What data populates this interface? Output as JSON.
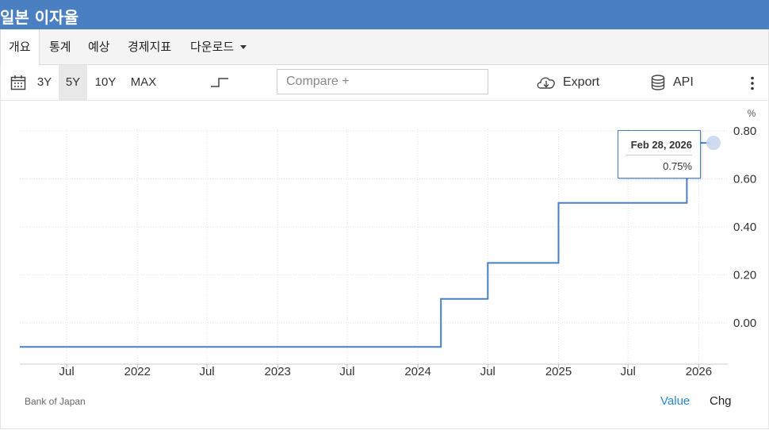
{
  "header": {
    "title": "일본 이자율"
  },
  "tabs": [
    {
      "label": "개요"
    },
    {
      "label": "통계"
    },
    {
      "label": "예상"
    },
    {
      "label": "경제지표"
    },
    {
      "label": "다운로드"
    }
  ],
  "toolbar": {
    "ranges": [
      "3Y",
      "5Y",
      "10Y",
      "MAX"
    ],
    "selected_range": "5Y",
    "compare_placeholder": "Compare +",
    "export_label": "Export",
    "api_label": "API",
    "icons": [
      "calendar-icon",
      "step-line-icon",
      "cloud-download-icon",
      "database-icon",
      "more-vert-icon"
    ]
  },
  "footer": {
    "source": "Bank of Japan",
    "value_label": "Value",
    "chg_label": "Chg"
  },
  "colors": {
    "header_bg": "#4a7fc1",
    "line": "#4a7fc1",
    "link": "#2a86d1"
  },
  "tooltip": {
    "date": "Feb 28, 2026",
    "value": "0.75%"
  },
  "chart_data": {
    "type": "line",
    "step": true,
    "ylabel": "%",
    "ylim": [
      -0.1,
      0.8
    ],
    "y_ticks": [
      "0.80",
      "0.60",
      "0.40",
      "0.20",
      "0.00"
    ],
    "x_ticks": [
      "Jul",
      "2022",
      "Jul",
      "2023",
      "Jul",
      "2024",
      "Jul",
      "2025",
      "Jul",
      "2026"
    ],
    "grid": true,
    "legend": "none",
    "series": [
      {
        "points": [
          {
            "x": "2021-03",
            "y": -0.1
          },
          {
            "x": "2024-03",
            "y": -0.1
          },
          {
            "x": "2024-03",
            "y": 0.1
          },
          {
            "x": "2024-07",
            "y": 0.1
          },
          {
            "x": "2024-07",
            "y": 0.25
          },
          {
            "x": "2025-01",
            "y": 0.25
          },
          {
            "x": "2025-01",
            "y": 0.5
          },
          {
            "x": "2025-12",
            "y": 0.5
          },
          {
            "x": "2025-12",
            "y": 0.75
          },
          {
            "x": "2026-02",
            "y": 0.75
          }
        ]
      }
    ]
  }
}
